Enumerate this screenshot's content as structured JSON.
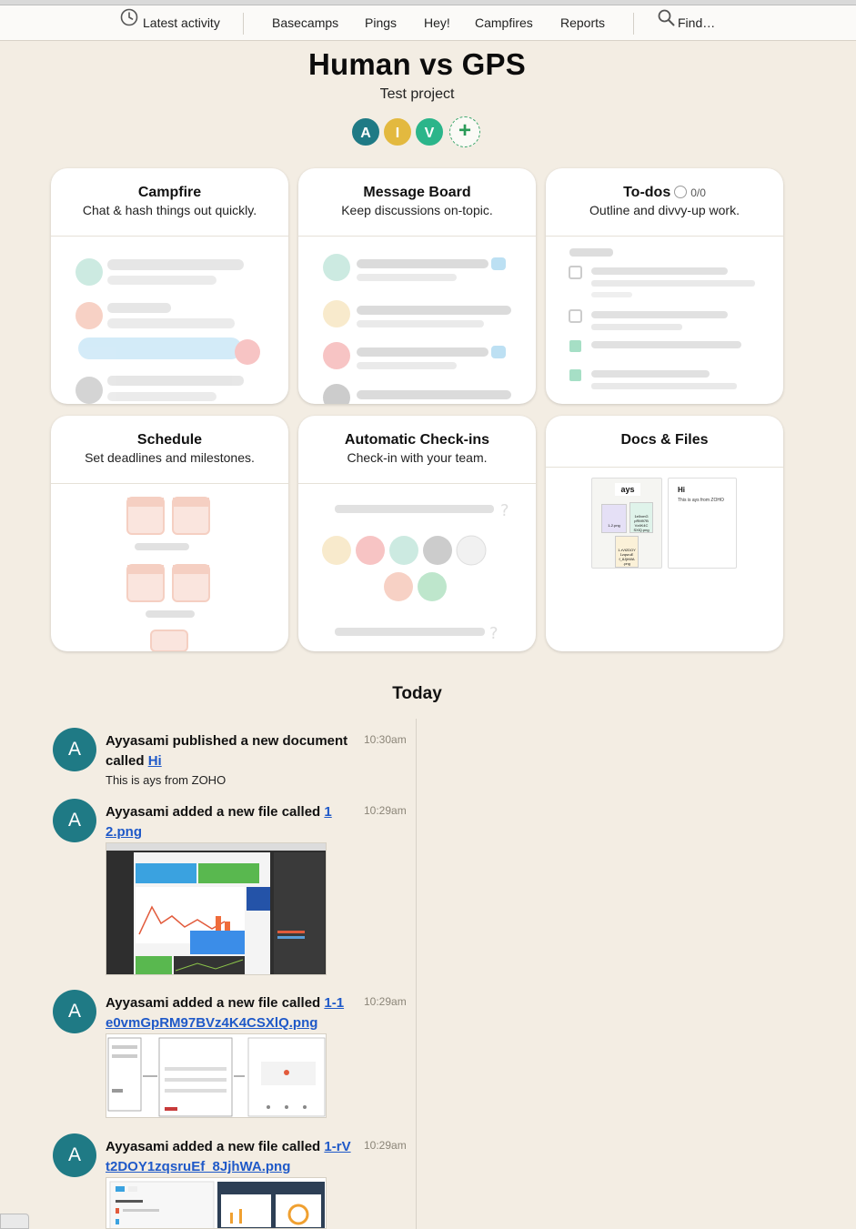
{
  "nav": {
    "latest_activity": "Latest activity",
    "basecamps": "Basecamps",
    "pings": "Pings",
    "hey": "Hey!",
    "campfires": "Campfires",
    "reports": "Reports",
    "find": "Find…"
  },
  "project": {
    "title": "Human vs GPS",
    "subtitle": "Test project",
    "people": [
      {
        "initial": "A",
        "color": "#1f7a85"
      },
      {
        "initial": "I",
        "color": "#e3b93f"
      },
      {
        "initial": "V",
        "color": "#2bb58a"
      }
    ],
    "add_person": "+"
  },
  "cards": {
    "campfire": {
      "title": "Campfire",
      "desc": "Chat & hash things out quickly."
    },
    "message_board": {
      "title": "Message Board",
      "desc": "Keep discussions on-topic."
    },
    "todos": {
      "title": "To-dos",
      "count": "0/0",
      "desc": "Outline and divvy-up work."
    },
    "schedule": {
      "title": "Schedule",
      "desc": "Set deadlines and milestones."
    },
    "checkins": {
      "title": "Automatic Check-ins",
      "desc": "Check-in with your team."
    },
    "docs": {
      "title": "Docs & Files",
      "folder_label": "ays",
      "file1": "1-2.png",
      "file2": "1e0vmG pRM97B Vz4K4C SXlQ.png",
      "file3": "1-rVt2DOY 1zqsruE f_8JjhWA .png",
      "doc_title": "Hi",
      "doc_text": "This is ays from ZOHO"
    }
  },
  "activity": {
    "heading": "Today",
    "entries": [
      {
        "initial": "A",
        "text": "Ayyasami published a new document called ",
        "link": "Hi",
        "time": "10:30am",
        "excerpt": "This is ays from ZOHO"
      },
      {
        "initial": "A",
        "text": "Ayyasami added a new file called ",
        "link": "1 2.png",
        "time": "10:29am"
      },
      {
        "initial": "A",
        "text": "Ayyasami added a new file called ",
        "link": "1-1e0vmGpRM97BVz4K4CSXlQ.png",
        "time": "10:29am"
      },
      {
        "initial": "A",
        "text": "Ayyasami added a new file called ",
        "link": "1-rVt2DOY1zqsruEf_8JjhWA.png",
        "time": "10:29am"
      }
    ]
  }
}
